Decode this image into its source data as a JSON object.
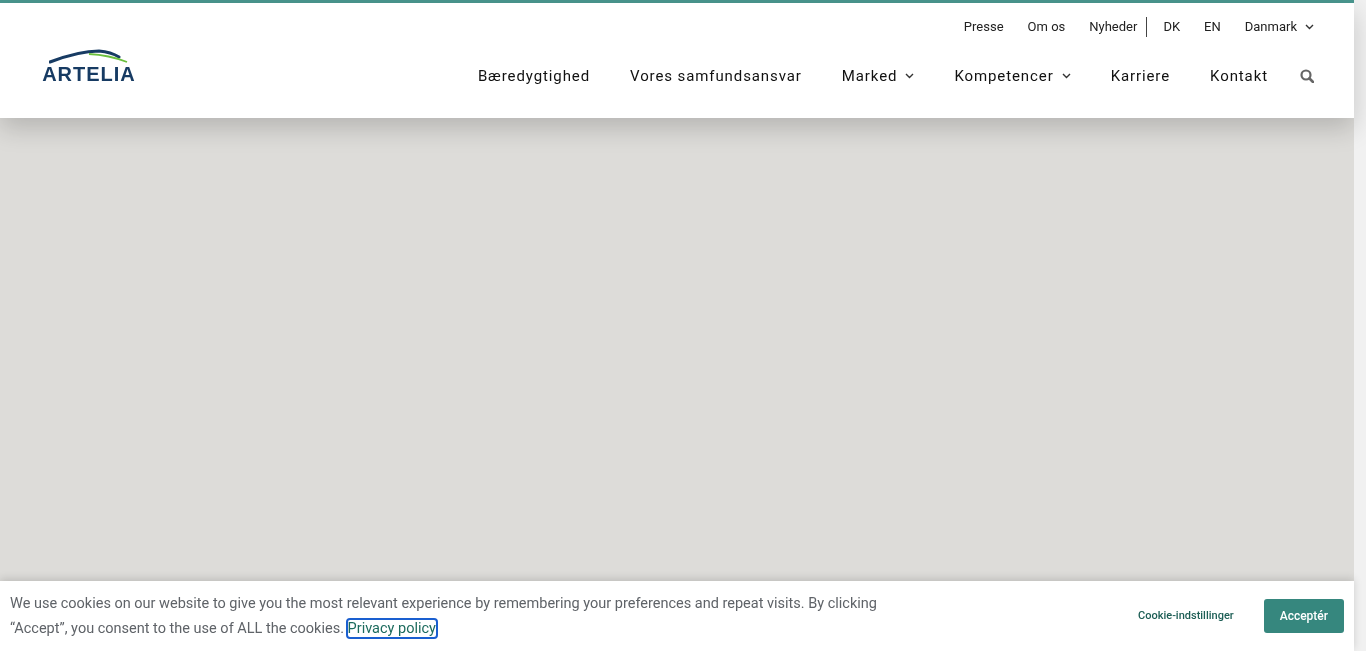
{
  "logo": {
    "text": "ARTELIA"
  },
  "utility_nav": [
    {
      "label": "Presse",
      "divider_after": false,
      "has_dropdown": false
    },
    {
      "label": "Om os",
      "divider_after": false,
      "has_dropdown": false
    },
    {
      "label": "Nyheder",
      "divider_after": true,
      "has_dropdown": false
    },
    {
      "label": "DK",
      "divider_after": false,
      "has_dropdown": false
    },
    {
      "label": "EN",
      "divider_after": false,
      "has_dropdown": false
    },
    {
      "label": "Danmark",
      "divider_after": false,
      "has_dropdown": true
    }
  ],
  "main_nav": [
    {
      "label": "Bæredygtighed",
      "has_dropdown": false
    },
    {
      "label": "Vores samfundsansvar",
      "has_dropdown": false
    },
    {
      "label": "Marked",
      "has_dropdown": true
    },
    {
      "label": "Kompetencer",
      "has_dropdown": true
    },
    {
      "label": "Karriere",
      "has_dropdown": false
    },
    {
      "label": "Kontakt",
      "has_dropdown": false
    }
  ],
  "cookie_banner": {
    "text": "We use cookies on our website to give you the most relevant experience by remembering your preferences and repeat visits. By clicking “Accept”, you consent to the use of ALL the cookies.",
    "link": {
      "label": "Privacy policy",
      "focused": true
    },
    "buttons": [
      {
        "label": "Cookie-indstillinger",
        "kind": "text"
      },
      {
        "label": "Acceptér",
        "kind": "primary"
      }
    ]
  }
}
